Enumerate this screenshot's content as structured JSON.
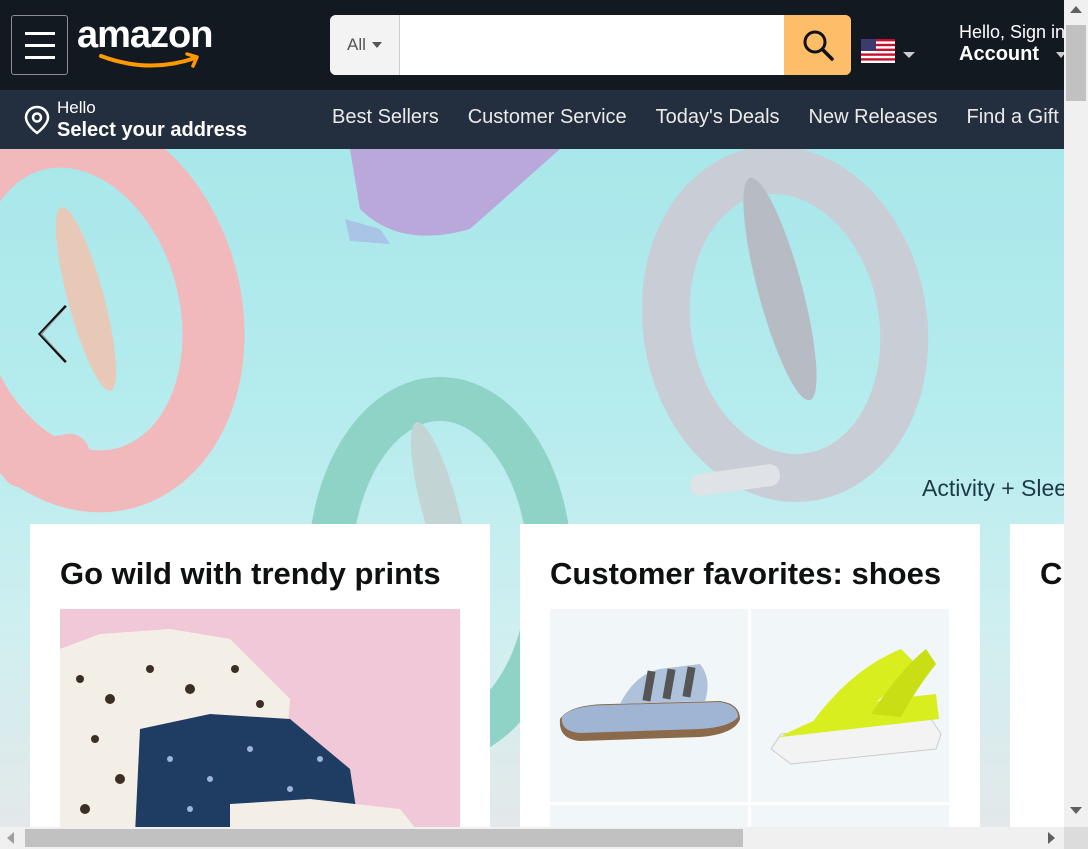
{
  "header": {
    "logo_text": "amazon",
    "search": {
      "category": "All",
      "placeholder": ""
    },
    "account": {
      "greeting": "Hello, Sign in",
      "label": "Account"
    }
  },
  "subnav": {
    "location_greeting": "Hello",
    "location_label": "Select your address",
    "links": [
      "Best Sellers",
      "Customer Service",
      "Today's Deals",
      "New Releases",
      "Find a Gift"
    ]
  },
  "hero": {
    "tagline": "Activity + Sleep"
  },
  "cards": [
    {
      "title": "Go wild with trendy prints"
    },
    {
      "title": "Customer favorites: shoes"
    },
    {
      "title": "C"
    }
  ],
  "colors": {
    "nav_bg": "#131921",
    "subnav_bg": "#232f3e",
    "search_button": "#febd69",
    "smile": "#ff9900"
  }
}
